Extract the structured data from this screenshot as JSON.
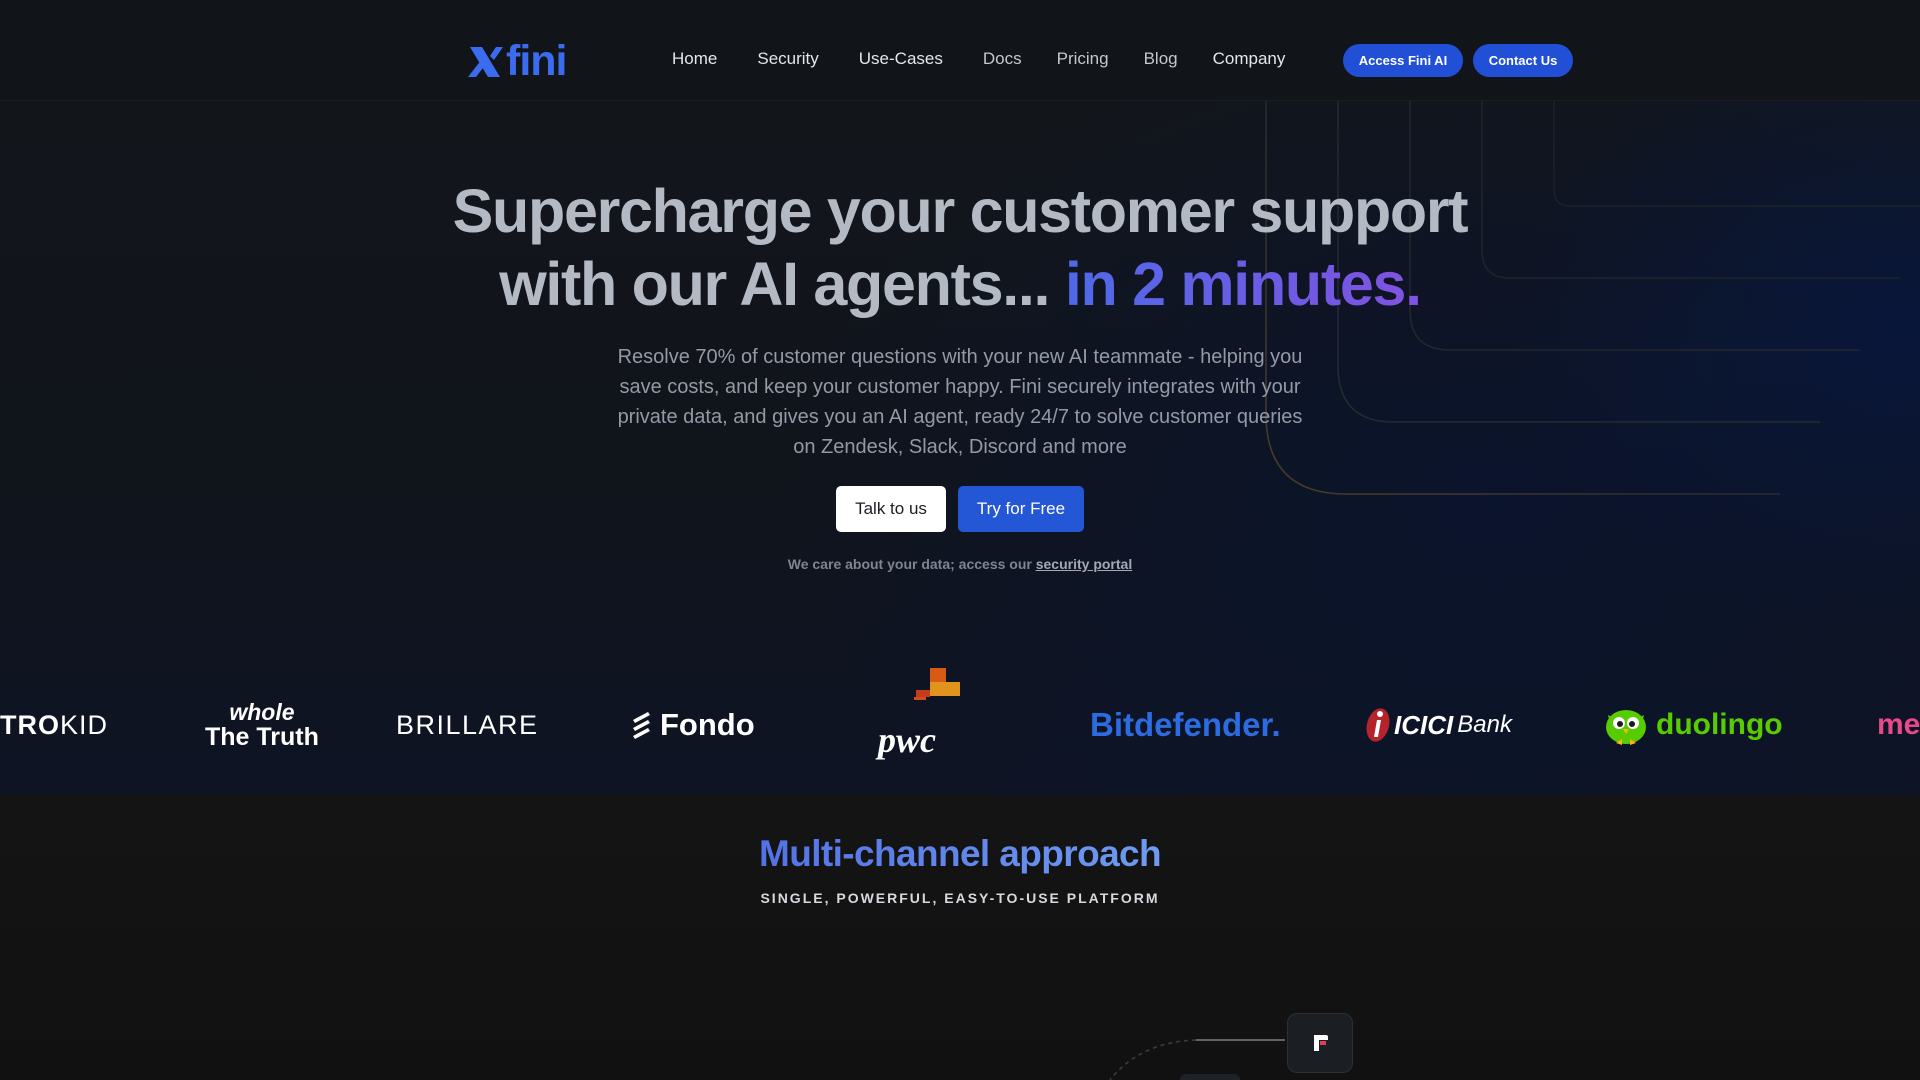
{
  "nav": {
    "logo_text": "fini",
    "links": [
      "Home",
      "Security",
      "Use-Cases",
      "Docs",
      "Pricing",
      "Blog",
      "Company"
    ],
    "access_button": "Access Fini AI",
    "contact_button": "Contact Us"
  },
  "hero": {
    "headline_line1": "Supercharge your customer support",
    "headline_line2": "with our AI agents...",
    "headline_accent": "in 2 minutes.",
    "subtext": "Resolve 70% of customer questions with your new AI teammate - helping you save costs, and keep your customer happy. Fini securely integrates with your private data, and gives you an AI agent, ready 24/7 to solve customer queries on Zendesk, Slack, Discord and more",
    "cta_talk": "Talk to us",
    "cta_try": "Try for Free",
    "data_note_prefix": "We care about your data; access our",
    "data_note_link": "security portal"
  },
  "logos": {
    "items": [
      "TROKID",
      "whole The Truth",
      "BRILLARE",
      "Fondo",
      "pwc",
      "Bitdefender.",
      "ICICI Bank",
      "duolingo",
      "me"
    ],
    "whole_top": "whole",
    "whole_bottom": "The Truth",
    "trokid_bold": "TRO",
    "trokid_light": "KID",
    "icici_bold": "ICICI",
    "icici_light": "Bank",
    "colors": {
      "bitdefender": "#2d6be0",
      "duolingo": "#58cc02",
      "icici": "#b5232d",
      "pwc_orange": "#e0701d",
      "partial_pink": "#e64a8a"
    }
  },
  "section": {
    "title": "Multi-channel approach",
    "subtitle": "SINGLE, POWERFUL, EASY-TO-USE PLATFORM"
  },
  "theme": {
    "brand_blue": "#2150d6",
    "accent_gradient": [
      "#4f69e8",
      "#8152e0"
    ]
  }
}
